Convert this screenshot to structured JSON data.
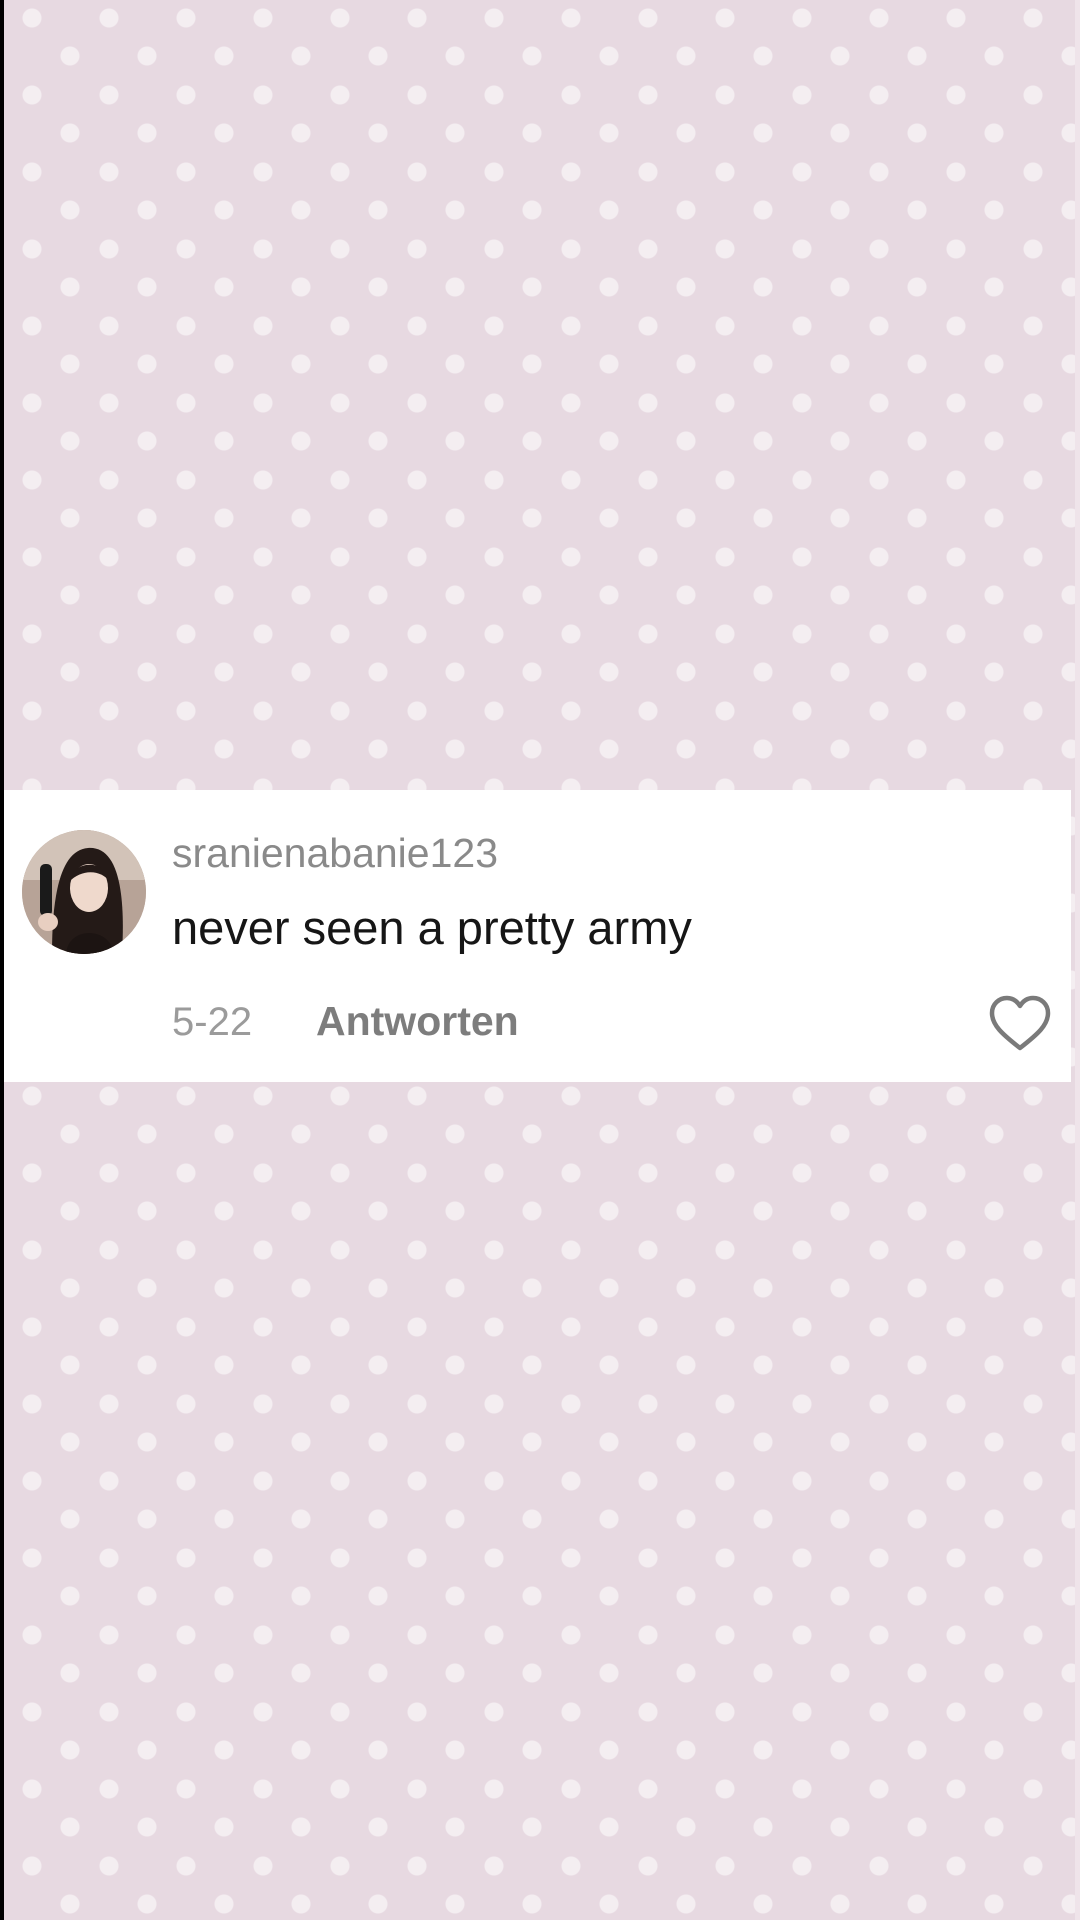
{
  "comment": {
    "username": "sranienabanie123",
    "text": "never seen a pretty army",
    "date": "5-22",
    "reply_label": "Antworten",
    "like_icon": "heart-outline-icon"
  },
  "colors": {
    "background": "#e7d9e1",
    "card": "#ffffff",
    "username": "#8a8a8a",
    "text": "#161616"
  }
}
